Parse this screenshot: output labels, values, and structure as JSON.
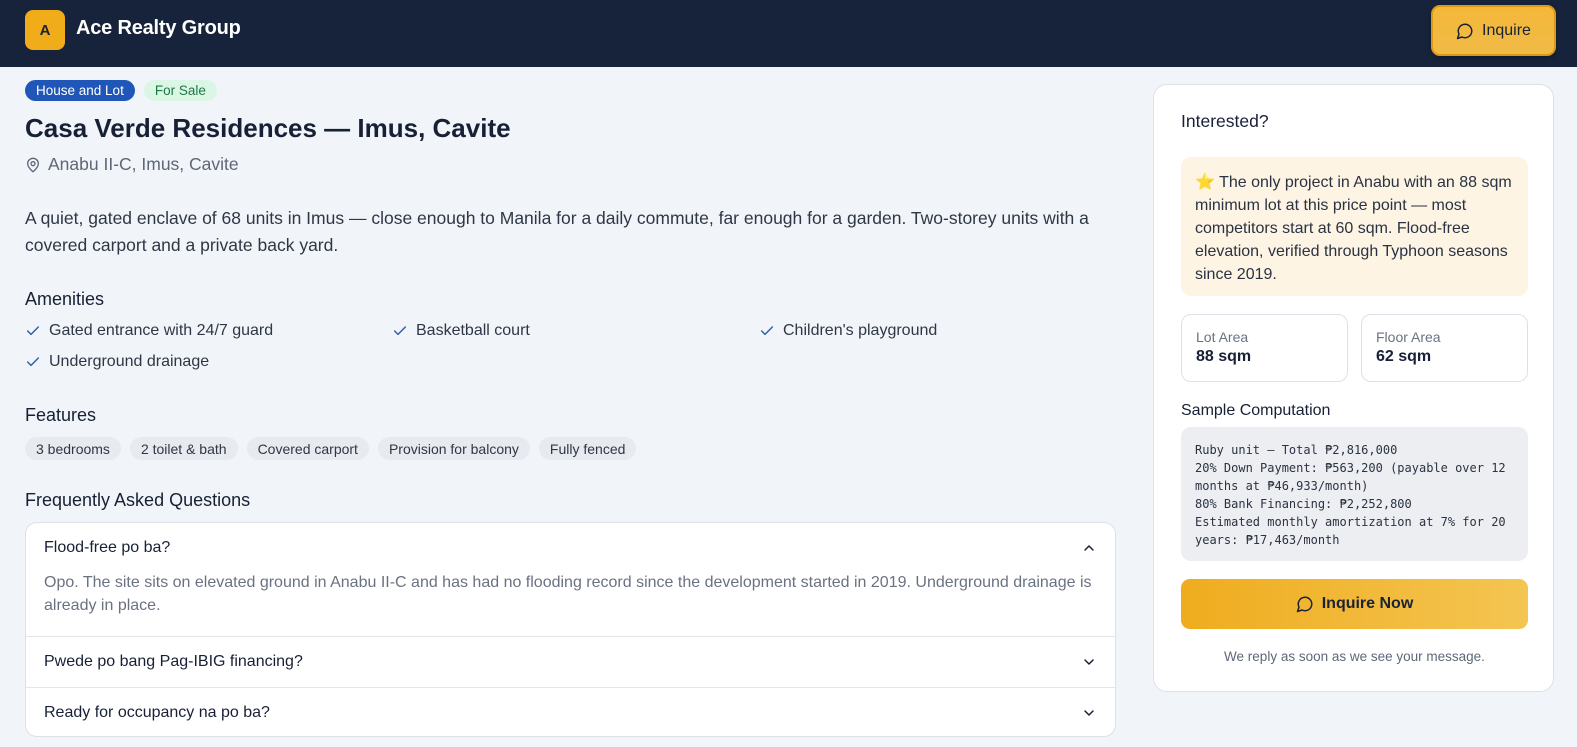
{
  "header": {
    "logo_letter": "A",
    "brand_name": "Ace Realty Group",
    "inquire_label": "Inquire"
  },
  "listing": {
    "badges": [
      "House and Lot",
      "For Sale"
    ],
    "title": "Casa Verde Residences — Imus, Cavite",
    "location": "Anabu II-C, Imus, Cavite",
    "description": "A quiet, gated enclave of 68 units in Imus — close enough to Manila for a daily commute, far enough for a garden. Two-storey units with a covered carport and a private back yard."
  },
  "amenities": {
    "heading": "Amenities",
    "items": [
      "Gated entrance with 24/7 guard",
      "Basketball court",
      "Children's playground",
      "Underground drainage"
    ]
  },
  "features": {
    "heading": "Features",
    "items": [
      "3 bedrooms",
      "2 toilet & bath",
      "Covered carport",
      "Provision for balcony",
      "Fully fenced"
    ]
  },
  "faq": {
    "heading": "Frequently Asked Questions",
    "items": [
      {
        "question": "Flood-free po ba?",
        "answer": "Opo. The site sits on elevated ground in Anabu II-C and has had no flooding record since the development started in 2019. Underground drainage is already in place.",
        "expanded": true
      },
      {
        "question": "Pwede po bang Pag-IBIG financing?",
        "expanded": false
      },
      {
        "question": "Ready for occupancy na po ba?",
        "expanded": false
      }
    ]
  },
  "sidebar": {
    "title": "Interested?",
    "highlight": "⭐ The only project in Anabu with an 88 sqm minimum lot at this price point — most competitors start at 60 sqm. Flood-free elevation, verified through Typhoon seasons since 2019.",
    "lot_area_label": "Lot Area",
    "lot_area_value": "88 sqm",
    "floor_area_label": "Floor Area",
    "floor_area_value": "62 sqm",
    "computation_heading": "Sample Computation",
    "computation_text": "Ruby unit — Total ₱2,816,000\n20% Down Payment: ₱563,200 (payable over 12 months at ₱46,933/month)\n80% Bank Financing: ₱2,252,800\nEstimated monthly amortization at 7% for 20 years: ₱17,463/month",
    "inquire_now_label": "Inquire Now",
    "note": "We reply as soon as we see your message."
  },
  "colors": {
    "header_bg": "#17233b",
    "accent": "#f0ad19",
    "badge_type": "#1f56b8",
    "badge_sale_bg": "#dcf6e6",
    "highlight_bg": "#fdf4e3"
  }
}
